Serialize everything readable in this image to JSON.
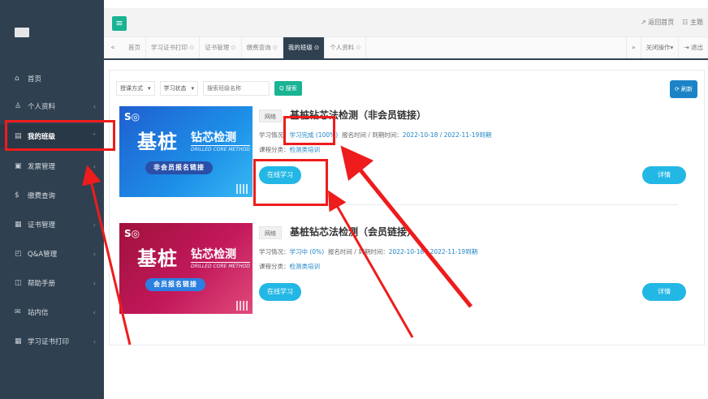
{
  "sidebar": {
    "items": [
      {
        "icon": "⌂",
        "label": "首页",
        "has_arrow": false,
        "active": false
      },
      {
        "icon": "♙",
        "label": "个人资料",
        "has_arrow": true,
        "active": false
      },
      {
        "icon": "▤",
        "label": "我的班级",
        "has_arrow": true,
        "active": true
      },
      {
        "icon": "▣",
        "label": "发票管理",
        "has_arrow": true,
        "active": false
      },
      {
        "icon": "$",
        "label": "缴费查询",
        "has_arrow": false,
        "active": false
      },
      {
        "icon": "▦",
        "label": "证书管理",
        "has_arrow": true,
        "active": false
      },
      {
        "icon": "◰",
        "label": "Q&A管理",
        "has_arrow": true,
        "active": false
      },
      {
        "icon": "◫",
        "label": "帮助手册",
        "has_arrow": true,
        "active": false
      },
      {
        "icon": "✉",
        "label": "站内信",
        "has_arrow": true,
        "active": false
      },
      {
        "icon": "▦",
        "label": "学习证书打印",
        "has_arrow": true,
        "active": false
      }
    ],
    "arrow_right": "‹",
    "arrow_down": "˅"
  },
  "topbar": {
    "menu_icon": "≡",
    "back_home": "↗ 返回首页",
    "theme": "☷ 主题"
  },
  "tabbar": {
    "prev": "«",
    "next": "»",
    "tabs": [
      {
        "label": "首页",
        "close": "",
        "active": false
      },
      {
        "label": "学习证书打印",
        "close": "⊙",
        "active": false
      },
      {
        "label": "证书管理",
        "close": "⊙",
        "active": false
      },
      {
        "label": "缴费查询",
        "close": "⊙",
        "active": false
      },
      {
        "label": "我的班级",
        "close": "⊙",
        "active": true
      },
      {
        "label": "个人资料",
        "close": "⊙",
        "active": false
      }
    ],
    "close_ops": "关闭操作▾",
    "logout": "⇥ 退出"
  },
  "toolbar": {
    "mode_select": "授课方式",
    "status_select": "学习状态",
    "caret": "▾",
    "search_placeholder": "搜索班级名称",
    "search_btn": "Q 搜索",
    "refresh_btn": "⟳ 刷新"
  },
  "courses": [
    {
      "type": "网络",
      "title": "基桩钻芯法检测（非会员链接）",
      "status_label": "学习情况：",
      "status_value": "学习完成 (100%)",
      "time_label": "报名时间 / 到期时间：",
      "time_value": "2022-10-18 / 2022-11-19到期",
      "category_label": "课程分类：",
      "category_value": "检测类培训",
      "study_btn": "在线学习",
      "detail_btn": "详情",
      "banner": {
        "theme": "blue",
        "logo": "S◎",
        "big": "基桩",
        "small": "钻芯检测",
        "en": "DRILLED CORE METHOD",
        "tag": "非会员报名链接"
      }
    },
    {
      "type": "网络",
      "title": "基桩钻芯法检测（会员链接）",
      "status_label": "学习情况：",
      "status_value": "学习中 (0%)",
      "time_label": "报名时间 / 到期时间：",
      "time_value": "2022-10-18 / 2022-11-19到期",
      "category_label": "课程分类：",
      "category_value": "检测类培训",
      "study_btn": "在线学习",
      "detail_btn": "详情",
      "banner": {
        "theme": "red",
        "logo": "S◎",
        "big": "基桩",
        "small": "钻芯检测",
        "en": "DRILLED CORE METHOD",
        "tag": "会员报名链接"
      }
    }
  ],
  "annotation": {
    "color": "#ee1c1c"
  }
}
